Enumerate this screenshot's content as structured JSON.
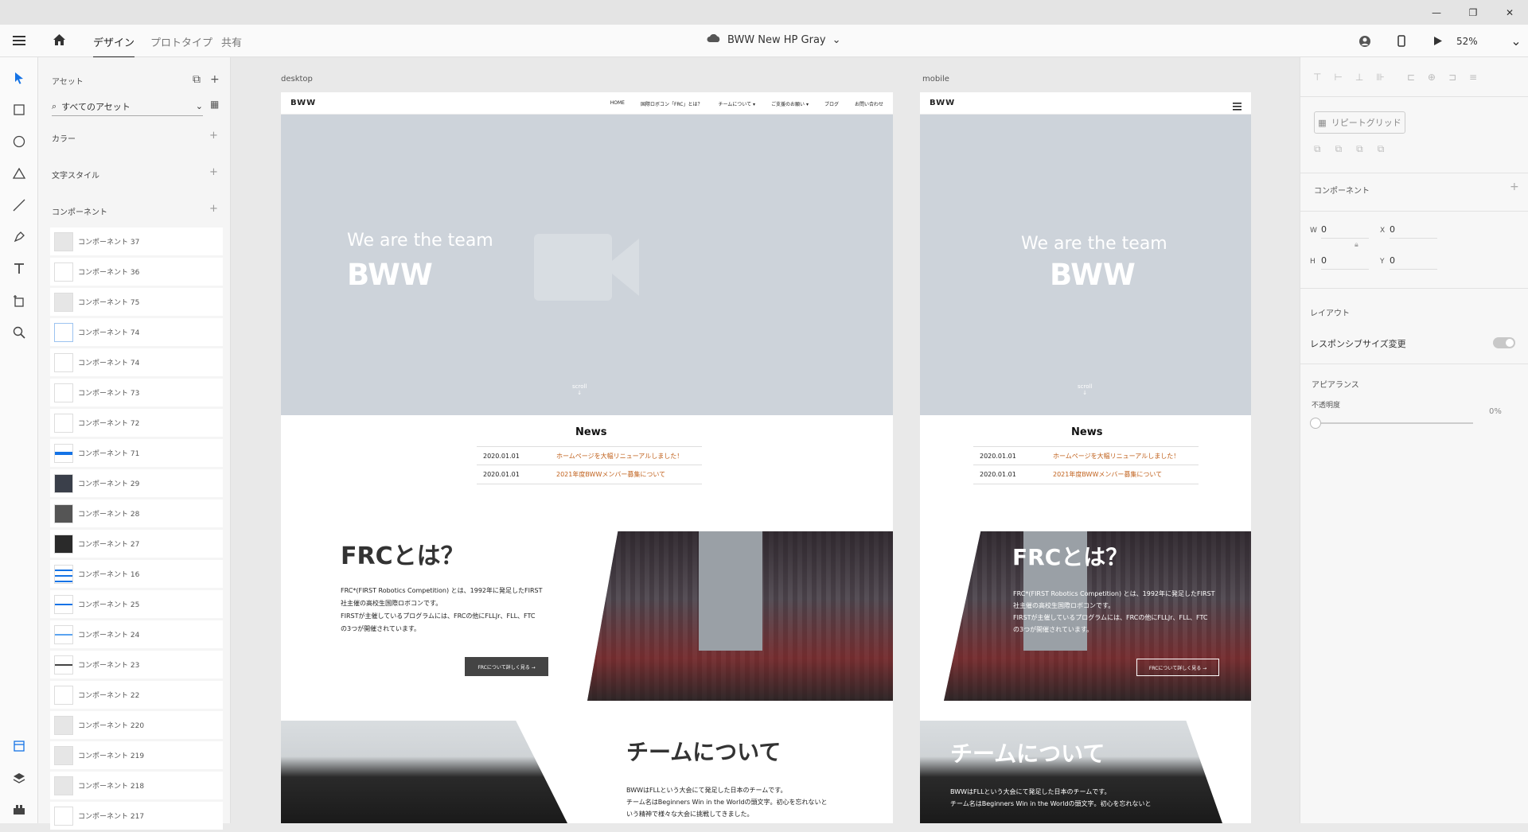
{
  "window": {
    "minimize": "—",
    "restore": "❐",
    "close": "✕"
  },
  "appbar": {
    "tabs": [
      {
        "label": "デザイン"
      },
      {
        "label": "プロトタイプ"
      },
      {
        "label": "共有"
      }
    ],
    "doc_title": "BWW New HP Gray",
    "zoom": "52%"
  },
  "assets": {
    "header": "アセット",
    "filter_label": "すべてのアセット",
    "colors_label": "カラー",
    "text_styles_label": "文字スタイル",
    "components_label": "コンポーネント",
    "components": [
      "コンポーネント 37",
      "コンポーネント 36",
      "コンポーネント 75",
      "コンポーネント 74",
      "コンポーネント 74",
      "コンポーネント 73",
      "コンポーネント 72",
      "コンポーネント 71",
      "コンポーネント 29",
      "コンポーネント 28",
      "コンポーネント 27",
      "コンポーネント 16",
      "コンポーネント 25",
      "コンポーネント 24",
      "コンポーネント 23",
      "コンポーネント 22",
      "コンポーネント 220",
      "コンポーネント 219",
      "コンポーネント 218",
      "コンポーネント 217"
    ]
  },
  "desktop": {
    "label": "desktop",
    "logo": "BWW",
    "nav": [
      "HOME",
      "国際ロボコン「FRC」とは？",
      "チームについて ▾",
      "ご支援のお願い ▾",
      "ブログ",
      "お問い合わせ"
    ],
    "hero_tag": "We are the team",
    "hero_big": "BWW",
    "scroll": "scroll",
    "news_title": "News",
    "news": [
      {
        "date": "2020.01.01",
        "text": "ホームページを大幅リニューアルしました！"
      },
      {
        "date": "2020.01.01",
        "text": "2021年度BWWメンバー募集について"
      }
    ],
    "frc_title": "FRCとは？",
    "frc_para": [
      "FRC*(FIRST Robotics Competition) とは、1992年に発足したFIRST",
      "社主催の高校生国際ロボコンです。",
      "FIRSTが主催しているプログラムには、FRCの他にFLLJr、FLL、FTC",
      "の3つが開催されています。"
    ],
    "frc_button": "FRCについて詳しく見る →",
    "team_title": "チームについて",
    "team_para": [
      "BWWはFLLという大会にて発足した日本のチームです。",
      "チーム名はBeginners Win in the Worldの頭文字。初心を忘れないと",
      "いう精神で様々な大会に挑戦してきました。"
    ]
  },
  "mobile": {
    "label": "mobile",
    "logo": "BWW",
    "hero_tag": "We are the team",
    "hero_big": "BWW",
    "scroll": "scroll",
    "news_title": "News",
    "news": [
      {
        "date": "2020.01.01",
        "text": "ホームページを大幅リニューアルしました！"
      },
      {
        "date": "2020.01.01",
        "text": "2021年度BWWメンバー募集について"
      }
    ],
    "frc_title": "FRCとは？",
    "frc_para": [
      "FRC*(FIRST Robotics Competition) とは、1992年に発足したFIRST",
      "社主催の高校生国際ロボコンです。",
      "FIRSTが主催しているプログラムには、FRCの他にFLLJr、FLL、FTC",
      "の3つが開催されています。"
    ],
    "frc_button": "FRCについて詳しく見る →",
    "team_title": "チームについて",
    "team_para": [
      "BWWはFLLという大会にて発足した日本のチームです。",
      "チーム名はBeginners Win in the Worldの頭文字。初心を忘れないと"
    ]
  },
  "props": {
    "repeat_grid": "リピートグリッド",
    "component_label": "コンポーネント",
    "w_label": "W",
    "w": "0",
    "x_label": "X",
    "x": "0",
    "h_label": "H",
    "h": "0",
    "y_label": "Y",
    "y": "0",
    "layout_label": "レイアウト",
    "responsive_label": "レスポンシブサイズ変更",
    "appearance_label": "アピアランス",
    "opacity_label": "不透明度",
    "opacity_value": "0%"
  }
}
